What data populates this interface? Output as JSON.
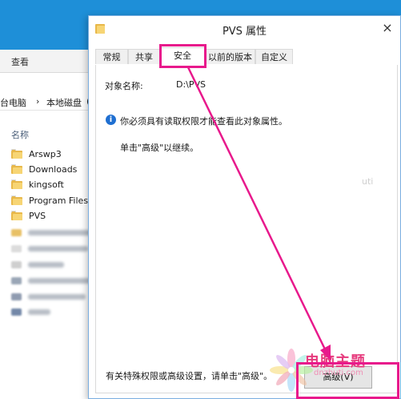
{
  "explorer": {
    "ribbon_tab": "查看",
    "address_parts": [
      "台电脑",
      "›",
      "本地磁盘",
      "("
    ],
    "column_header": "名称",
    "folders": [
      "Arswp3",
      "Downloads",
      "kingsoft",
      "Program Files",
      "PVS"
    ],
    "folder_color": "#e8b84a"
  },
  "dialog": {
    "title": "PVS 属性",
    "close_glyph": "×",
    "tabs": [
      "常规",
      "共享",
      "安全",
      "以前的版本",
      "自定义"
    ],
    "active_tab": "安全",
    "object_label": "对象名称:",
    "object_value": "D:\\PVS",
    "info_icon": "i",
    "permission_message": "你必须具有读取权限才能查看此对象属性。",
    "continue_hint": "单击\"高级\"以继续。",
    "footer_hint": "有关特殊权限或高级设置，请单击\"高级\"。",
    "advanced_button": "高级(V)"
  },
  "annotation": {
    "color": "#e8198c"
  },
  "watermark": {
    "brand": "电脑主题",
    "domain": "dnzhuti.com",
    "faint_mark": "uti"
  }
}
